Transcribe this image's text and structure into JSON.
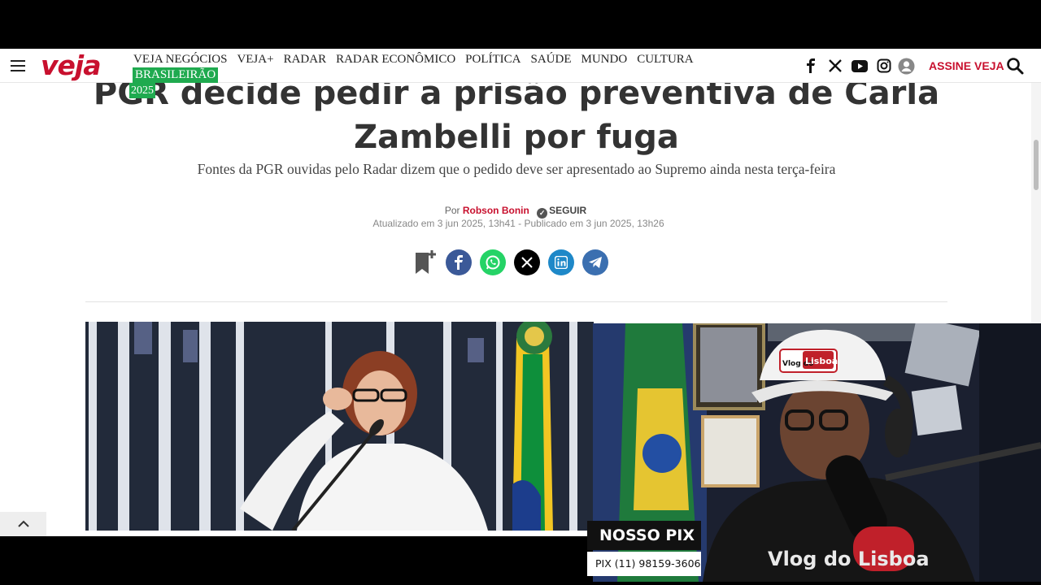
{
  "site": {
    "logo": "veja",
    "nav": [
      "VEJA NEGÓCIOS",
      "VEJA+",
      "RADAR",
      "RADAR ECONÔMICO",
      "POLÍTICA",
      "SAÚDE",
      "MUNDO",
      "CULTURA"
    ],
    "nav_highlight": "BRASILEIRÃO",
    "nav_highlight_year": "2025",
    "subscribe_label": "ASSINE VEJA",
    "social_icons": [
      "facebook-icon",
      "x-icon",
      "youtube-icon",
      "instagram-icon",
      "user-icon"
    ],
    "brand_color": "#c8102e",
    "highlight_color": "#1faa4f"
  },
  "article": {
    "headline_line1": "PGR decide pedir a prisão preventiva de Carla",
    "headline_line2": "Zambelli por fuga",
    "subtitle": "Fontes da PGR ouvidas pelo Radar dizem que o pedido deve ser apresentado ao Supremo ainda nesta terça-feira",
    "by_prefix": "Por",
    "author": "Robson Bonin",
    "follow_label": "SEGUIR",
    "dates": "Atualizado em 3 jun 2025, 13h41 - Publicado em 3 jun 2025, 13h26",
    "share": [
      {
        "icon": "bookmark-add-icon",
        "color": "#555555"
      },
      {
        "icon": "facebook-icon",
        "color": "#3b5998"
      },
      {
        "icon": "whatsapp-icon",
        "color": "#25d366"
      },
      {
        "icon": "x-icon",
        "color": "#000000"
      },
      {
        "icon": "linkedin-icon",
        "color": "#1e88c8"
      },
      {
        "icon": "telegram-icon",
        "color": "#3b6fb0"
      }
    ]
  },
  "overlay": {
    "cap_text": "Lisboa",
    "cap_prefix": "Vlog do",
    "shirt_text": "Vlog do Lisboa",
    "pix_title": "NOSSO PIX",
    "pix_number": "PIX (11) 98159-3606"
  }
}
